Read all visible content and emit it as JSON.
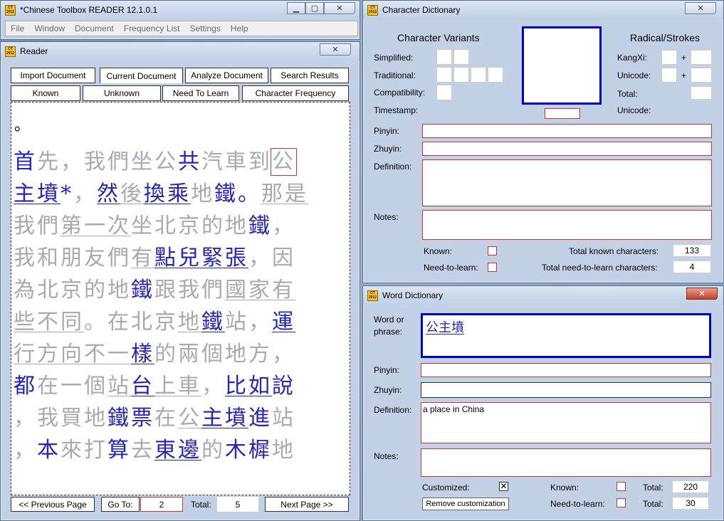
{
  "main_window": {
    "title": "*Chinese Toolbox READER 12.1.0.1",
    "menu": [
      "File",
      "Window",
      "Document",
      "Frequency List",
      "Settings",
      "Help"
    ]
  },
  "reader": {
    "title": "Reader",
    "tabs_row1": [
      "Import Document",
      "Current Document",
      "Analyze Document",
      "Search Results"
    ],
    "tabs_row2": [
      "Known",
      "Unknown",
      "Need To Learn",
      "Character Frequency"
    ],
    "top_mark": "。",
    "text_lines": [
      [
        [
          "首",
          "k",
          ""
        ],
        [
          "先",
          "u",
          ""
        ],
        [
          "，",
          "u",
          ""
        ],
        [
          "我",
          "u",
          ""
        ],
        [
          "們",
          "u",
          ""
        ],
        [
          "坐",
          "u",
          ""
        ],
        [
          "公",
          "u",
          ""
        ],
        [
          "共",
          "k",
          ""
        ],
        [
          "汽",
          "u",
          ""
        ],
        [
          "車",
          "u",
          ""
        ],
        [
          "到",
          "u",
          ""
        ],
        [
          "公",
          "u",
          "sel"
        ]
      ],
      [
        [
          "主",
          "k",
          "l"
        ],
        [
          "墳",
          "k",
          "l"
        ],
        [
          "*",
          "k",
          ""
        ],
        [
          "，",
          "u",
          ""
        ],
        [
          "然",
          "k",
          "l"
        ],
        [
          "後",
          "u",
          "l"
        ],
        [
          "換",
          "k",
          "l"
        ],
        [
          "乘",
          "k",
          "l"
        ],
        [
          "地",
          "u",
          ""
        ],
        [
          "鐵",
          "k",
          ""
        ],
        [
          "。",
          "k",
          ""
        ],
        [
          "那",
          "u",
          "l"
        ],
        [
          "是",
          "u",
          "l"
        ]
      ],
      [
        [
          "我",
          "u",
          ""
        ],
        [
          "們",
          "u",
          ""
        ],
        [
          "第",
          "u",
          "l"
        ],
        [
          "一",
          "u",
          "l"
        ],
        [
          "次",
          "u",
          "l"
        ],
        [
          "坐",
          "u",
          ""
        ],
        [
          "北",
          "u",
          ""
        ],
        [
          "京",
          "u",
          ""
        ],
        [
          "的",
          "u",
          ""
        ],
        [
          "地",
          "u",
          ""
        ],
        [
          "鐵",
          "k",
          ""
        ],
        [
          "，",
          "u",
          ""
        ]
      ],
      [
        [
          "我",
          "u",
          ""
        ],
        [
          "和",
          "u",
          ""
        ],
        [
          "朋",
          "u",
          ""
        ],
        [
          "友",
          "u",
          ""
        ],
        [
          "們",
          "u",
          ""
        ],
        [
          "有",
          "u",
          "l"
        ],
        [
          "點",
          "k",
          "l"
        ],
        [
          "兒",
          "k",
          "l"
        ],
        [
          "緊",
          "k",
          "l"
        ],
        [
          "張",
          "k",
          "l"
        ],
        [
          "，",
          "u",
          ""
        ],
        [
          "因",
          "u",
          ""
        ]
      ],
      [
        [
          "為",
          "u",
          ""
        ],
        [
          "北",
          "u",
          ""
        ],
        [
          "京",
          "u",
          ""
        ],
        [
          "的",
          "u",
          ""
        ],
        [
          "地",
          "u",
          ""
        ],
        [
          "鐵",
          "k",
          ""
        ],
        [
          "跟",
          "u",
          ""
        ],
        [
          "我",
          "u",
          ""
        ],
        [
          "們",
          "u",
          ""
        ],
        [
          "國",
          "u",
          "l"
        ],
        [
          "家",
          "u",
          "l"
        ],
        [
          "有",
          "u",
          "l"
        ]
      ],
      [
        [
          "些",
          "u",
          "l"
        ],
        [
          "不",
          "u",
          "l"
        ],
        [
          "同",
          "u",
          "l"
        ],
        [
          "。",
          "u",
          ""
        ],
        [
          "在",
          "u",
          ""
        ],
        [
          "北",
          "u",
          ""
        ],
        [
          "京",
          "u",
          ""
        ],
        [
          "地",
          "u",
          "l"
        ],
        [
          "鐵",
          "k",
          "l"
        ],
        [
          "站",
          "u",
          ""
        ],
        [
          "，",
          "u",
          ""
        ],
        [
          "運",
          "k",
          "l"
        ]
      ],
      [
        [
          "行",
          "u",
          "l"
        ],
        [
          "方",
          "u",
          "l"
        ],
        [
          "向",
          "u",
          "l"
        ],
        [
          "不",
          "u",
          "l"
        ],
        [
          "一",
          "u",
          "l"
        ],
        [
          "樣",
          "k",
          "l"
        ],
        [
          "的",
          "u",
          ""
        ],
        [
          "兩",
          "u",
          ""
        ],
        [
          "個",
          "u",
          ""
        ],
        [
          "地",
          "u",
          ""
        ],
        [
          "方",
          "u",
          ""
        ],
        [
          "，",
          "u",
          ""
        ]
      ],
      [
        [
          "都",
          "k",
          ""
        ],
        [
          "在",
          "u",
          ""
        ],
        [
          "一",
          "u",
          ""
        ],
        [
          "個",
          "u",
          ""
        ],
        [
          "站",
          "u",
          "l"
        ],
        [
          "台",
          "k",
          "l"
        ],
        [
          "上",
          "u",
          "l"
        ],
        [
          "車",
          "u",
          "l"
        ],
        [
          "，",
          "u",
          ""
        ],
        [
          "比",
          "k",
          "l"
        ],
        [
          "如",
          "k",
          "l"
        ],
        [
          "說",
          "k",
          ""
        ]
      ],
      [
        [
          "，",
          "u",
          ""
        ],
        [
          "我",
          "u",
          ""
        ],
        [
          "買",
          "u",
          ""
        ],
        [
          "地",
          "u",
          ""
        ],
        [
          "鐵",
          "k",
          ""
        ],
        [
          "票",
          "k",
          ""
        ],
        [
          "在",
          "u",
          ""
        ],
        [
          "公",
          "u",
          "l"
        ],
        [
          "主",
          "k",
          "l"
        ],
        [
          "墳",
          "k",
          "l"
        ],
        [
          "進",
          "k",
          ""
        ],
        [
          "站",
          "u",
          ""
        ]
      ],
      [
        [
          "，",
          "u",
          ""
        ],
        [
          "本",
          "k",
          ""
        ],
        [
          "來",
          "u",
          ""
        ],
        [
          "打",
          "u",
          ""
        ],
        [
          "算",
          "k",
          ""
        ],
        [
          "去",
          "u",
          ""
        ],
        [
          "東",
          "k",
          "l"
        ],
        [
          "邊",
          "k",
          "l"
        ],
        [
          "的",
          "u",
          ""
        ],
        [
          "木",
          "k",
          ""
        ],
        [
          "樨",
          "k",
          ""
        ],
        [
          "地",
          "u",
          ""
        ]
      ]
    ],
    "prev_page": "<< Previous Page",
    "goto_label": "Go To:",
    "goto_value": "2",
    "total_label": "Total:",
    "total_value": "5",
    "next_page": "Next Page >>"
  },
  "char_dict": {
    "title": "Character Dictionary",
    "variants_heading": "Character Variants",
    "radical_heading": "Radical/Strokes",
    "simplified": "Simplified:",
    "traditional": "Traditional:",
    "compatibility": "Compatibility:",
    "timestamp": "Timestamp:",
    "kangxi": "KangXi:",
    "unicode1": "Unicode:",
    "total": "Total:",
    "unicode2": "Unicode:",
    "plus": "+",
    "pinyin": "Pinyin:",
    "zhuyin": "Zhuyin:",
    "definition": "Definition:",
    "notes": "Notes:",
    "known": "Known:",
    "need_to_learn": "Need-to-learn:",
    "total_known_label": "Total known characters:",
    "total_known_value": "133",
    "total_ntl_label": "Total need-to-learn characters:",
    "total_ntl_value": "4"
  },
  "word_dict": {
    "title": "Word Dictionary",
    "word_label": "Word or phrase:",
    "word_value": "公主墳",
    "pinyin": "Pinyin:",
    "zhuyin": "Zhuyin:",
    "definition": "Definition:",
    "definition_value": "a place in China",
    "notes": "Notes:",
    "customized": "Customized:",
    "known": "Known:",
    "need_to_learn": "Need-to-learn:",
    "total1_label": "Total:",
    "total1_value": "220",
    "total2_label": "Total:",
    "total2_value": "30",
    "remove_custom": "Remove customization"
  },
  "colors": {
    "known": "#2525b8",
    "unknown": "#a9a9b4",
    "field_border": "#cc3333",
    "active_border": "#0000cc"
  }
}
